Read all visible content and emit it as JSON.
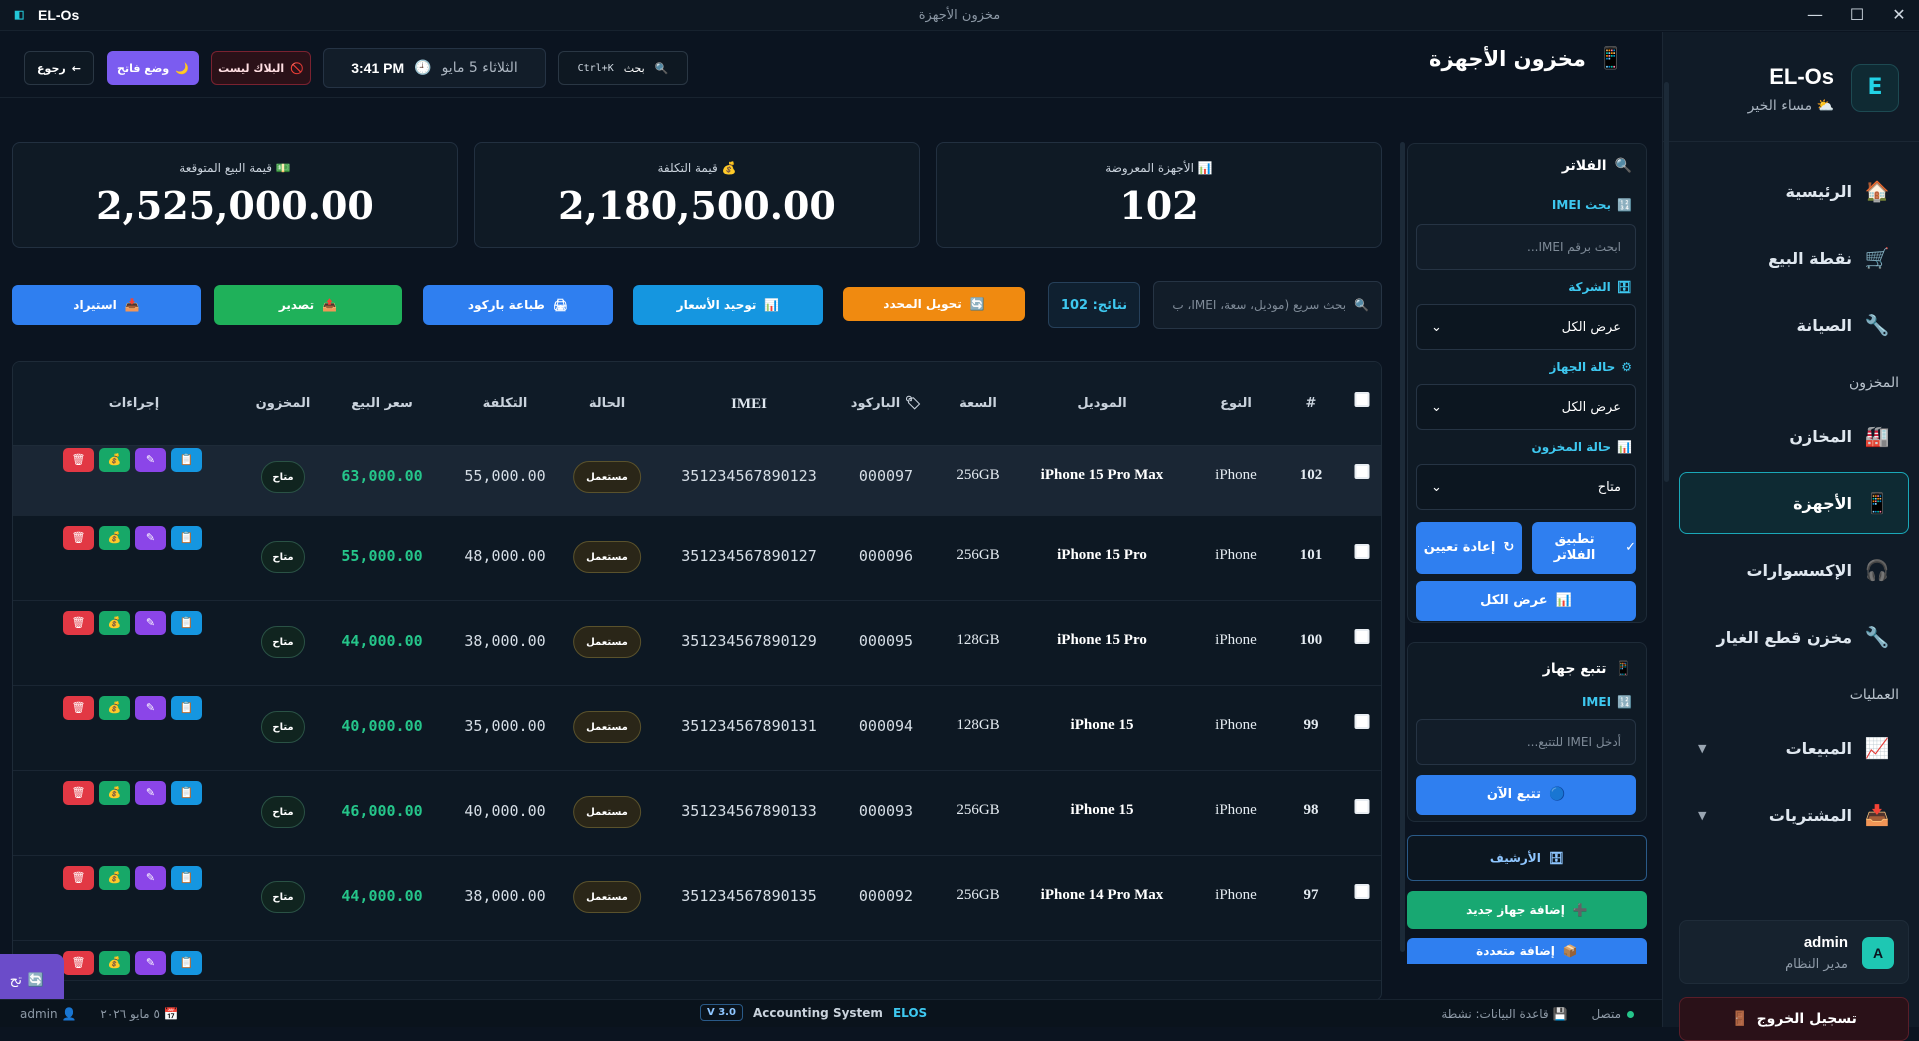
{
  "window": {
    "app_name": "EL-Os",
    "title": "مخزون الأجهزة"
  },
  "sidebar": {
    "brand": "EL-Os",
    "greeting": "مساء الخير",
    "items": [
      {
        "label": "الرئيسية",
        "icon": "🏠"
      },
      {
        "label": "نقطة البيع",
        "icon": "🛒"
      },
      {
        "label": "الصيانة",
        "icon": "🔧"
      }
    ],
    "section_inventory": "المخزون",
    "inventory_items": [
      {
        "label": "المخازن",
        "icon": "🏭"
      },
      {
        "label": "الأجهزة",
        "icon": "📱"
      },
      {
        "label": "الإكسسوارات",
        "icon": "🎧"
      },
      {
        "label": "مخزن قطع الغيار",
        "icon": "🔧"
      }
    ],
    "section_ops": "العمليات",
    "ops_items": [
      {
        "label": "المبيعات",
        "icon": "📈"
      },
      {
        "label": "المشتريات",
        "icon": "📥"
      }
    ],
    "user": {
      "name": "admin",
      "role": "مدير النظام",
      "initial": "A"
    },
    "logout": "تسجيل الخروج"
  },
  "header": {
    "title": "مخزون الأجهزة",
    "search_label": "بحث",
    "search_shortcut": "Ctrl+K",
    "date": "الثلاثاء 5 مايو",
    "time": "3:41 PM",
    "blacklist": "البلاك ليست",
    "night_mode": "وضع فاتح",
    "back": "رجوع"
  },
  "stats": [
    {
      "label": "الأجهزة المعروضة",
      "value": "102",
      "icon": "📊"
    },
    {
      "label": "قيمة التكلفة",
      "value": "2,180,500.00",
      "icon": "💰"
    },
    {
      "label": "قيمة البيع المتوقعة",
      "value": "2,525,000.00",
      "icon": "💵"
    }
  ],
  "actions": {
    "quick_search_placeholder": "بحث سريع (موديل، سعة، IMEI، ب",
    "results": "نتائج: 102",
    "transfer": "تحويل المحدد",
    "unify_prices": "توحيد الأسعار",
    "print_barcode": "طباعة باركود",
    "export": "تصدير",
    "import": "استيراد"
  },
  "table": {
    "headers": {
      "num": "#",
      "type": "النوع",
      "model": "الموديل",
      "capacity": "السعة",
      "barcode": "الباركود",
      "imei": "IMEI",
      "status": "الحالة",
      "cost": "التكلفة",
      "price": "سعر البيع",
      "stock": "المخزون",
      "actions": "إجراءات"
    },
    "rows": [
      {
        "num": "102",
        "type": "iPhone",
        "model": "iPhone 15 Pro Max",
        "capacity": "256GB",
        "barcode": "000097",
        "imei": "351234567890123",
        "status": "مستعمل",
        "cost": "55,000.00",
        "price": "63,000.00",
        "stock": "متاح"
      },
      {
        "num": "101",
        "type": "iPhone",
        "model": "iPhone 15 Pro",
        "capacity": "256GB",
        "barcode": "000096",
        "imei": "351234567890127",
        "status": "مستعمل",
        "cost": "48,000.00",
        "price": "55,000.00",
        "stock": "متاح"
      },
      {
        "num": "100",
        "type": "iPhone",
        "model": "iPhone 15 Pro",
        "capacity": "128GB",
        "barcode": "000095",
        "imei": "351234567890129",
        "status": "مستعمل",
        "cost": "38,000.00",
        "price": "44,000.00",
        "stock": "متاح"
      },
      {
        "num": "99",
        "type": "iPhone",
        "model": "iPhone 15",
        "capacity": "128GB",
        "barcode": "000094",
        "imei": "351234567890131",
        "status": "مستعمل",
        "cost": "35,000.00",
        "price": "40,000.00",
        "stock": "متاح"
      },
      {
        "num": "98",
        "type": "iPhone",
        "model": "iPhone 15",
        "capacity": "256GB",
        "barcode": "000093",
        "imei": "351234567890133",
        "status": "مستعمل",
        "cost": "40,000.00",
        "price": "46,000.00",
        "stock": "متاح"
      },
      {
        "num": "97",
        "type": "iPhone",
        "model": "iPhone 14 Pro Max",
        "capacity": "256GB",
        "barcode": "000092",
        "imei": "351234567890135",
        "status": "مستعمل",
        "cost": "38,000.00",
        "price": "44,000.00",
        "stock": "متاح"
      }
    ]
  },
  "filters": {
    "title": "الفلاتر",
    "imei_label": "بحث IMEI",
    "imei_placeholder": "ابحث برقم IMEI...",
    "company_label": "الشركة",
    "company_value": "عرض الكل",
    "device_status_label": "حالة الجهاز",
    "device_status_value": "عرض الكل",
    "stock_status_label": "حالة المخزون",
    "stock_status_value": "متاح",
    "apply": "تطبيق الفلاتر",
    "reset": "إعادة تعيين",
    "show_all": "عرض الكل"
  },
  "tracker": {
    "title": "تتبع جهاز",
    "imei_label": "IMEI",
    "placeholder": "أدخل IMEI للتتبع...",
    "track_now": "تتبع الآن"
  },
  "side_actions": {
    "archive": "الأرشيف",
    "add_one": "إضافة جهاز جديد",
    "add_many": "إضافة متعددة"
  },
  "float_button": "تح",
  "statusbar": {
    "connected": "متصل",
    "db": "قاعدة البيانات: نشطة",
    "version": "V 3.0",
    "system": "Accounting System",
    "brand": "ELOS",
    "date": "٥ مايو ٢٠٢٦",
    "user": "admin"
  }
}
